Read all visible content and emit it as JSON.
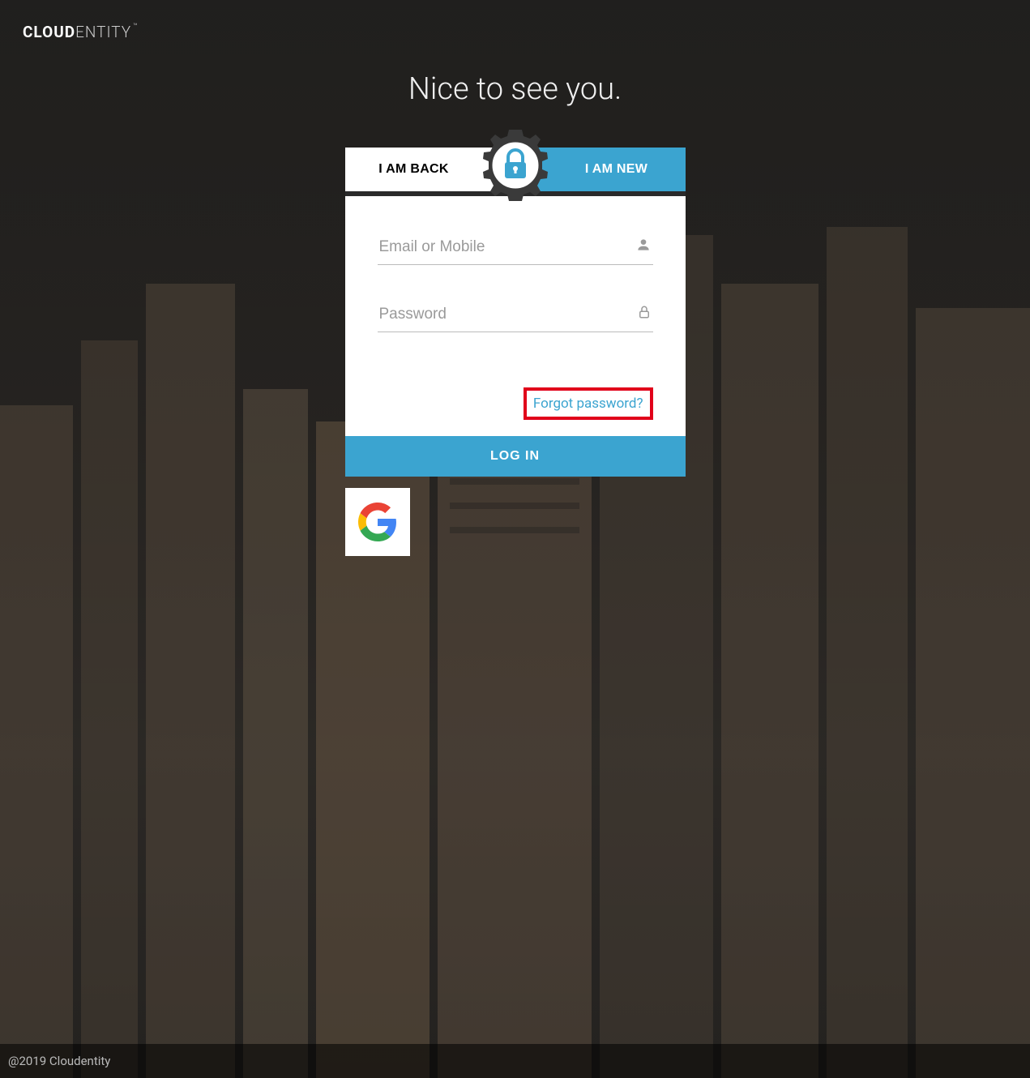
{
  "logo": {
    "bold": "CLOUD",
    "light": "ENTITY",
    "tm": "™"
  },
  "heading": "Nice to see you.",
  "tabs": {
    "back": "I AM BACK",
    "new": "I AM NEW"
  },
  "form": {
    "email_placeholder": "Email or Mobile",
    "password_placeholder": "Password",
    "forgot_label": "Forgot password?",
    "login_label": "LOG IN"
  },
  "social": {
    "google_name": "Google"
  },
  "footer": {
    "copyright": "@2019 Cloudentity"
  },
  "colors": {
    "accent": "#3ba4d0",
    "highlight_border": "#e1001a"
  }
}
